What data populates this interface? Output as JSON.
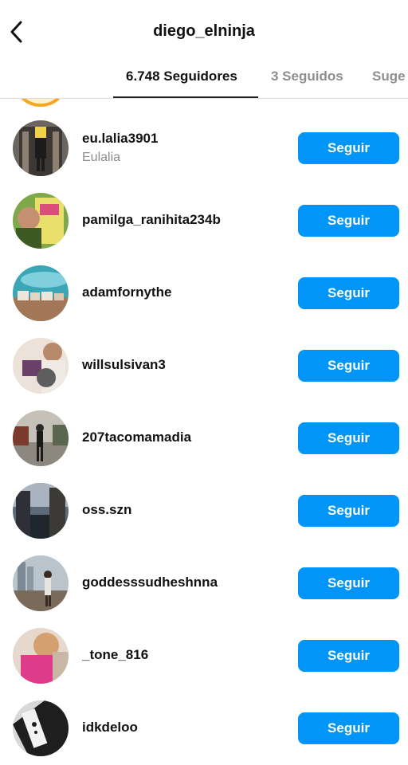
{
  "header": {
    "title": "diego_elninja",
    "back_icon": "chevron-left-icon"
  },
  "tabs": [
    {
      "label": "6.748 Seguidores",
      "active": true
    },
    {
      "label": "3 Seguidos",
      "active": false
    },
    {
      "label": "Suge",
      "active": false
    }
  ],
  "colors": {
    "follow_button": "#0095f6",
    "active_tab": "#111111",
    "inactive_tab": "#8e8e8e"
  },
  "followers": [
    {
      "username": "eu.lalia3901",
      "full_name": "Eulalia",
      "button_label": "Seguir"
    },
    {
      "username": "pamilga_ranihita234b",
      "full_name": "",
      "button_label": "Seguir"
    },
    {
      "username": "adamfornythe",
      "full_name": "",
      "button_label": "Seguir"
    },
    {
      "username": "willsulsivan3",
      "full_name": "",
      "button_label": "Seguir"
    },
    {
      "username": "207tacomamadia",
      "full_name": "",
      "button_label": "Seguir"
    },
    {
      "username": "oss.szn",
      "full_name": "",
      "button_label": "Seguir"
    },
    {
      "username": "goddesssudheshnna",
      "full_name": "",
      "button_label": "Seguir"
    },
    {
      "username": "_tone_816",
      "full_name": "",
      "button_label": "Seguir"
    },
    {
      "username": "idkdeloo",
      "full_name": "",
      "button_label": "Seguir"
    }
  ]
}
